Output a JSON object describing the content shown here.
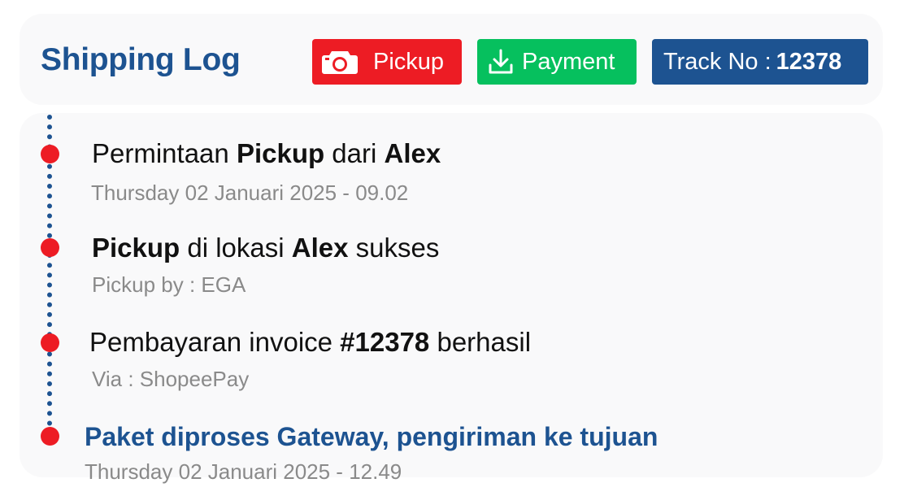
{
  "header": {
    "title": "Shipping Log",
    "pickup_label": "Pickup",
    "payment_label": "Payment",
    "track_prefix": "Track No :",
    "track_number": "12378"
  },
  "colors": {
    "brand_blue": "#1d5391",
    "pickup_red": "#ed1c24",
    "payment_green": "#06c05e"
  },
  "icons": {
    "pickup": "camera-icon",
    "payment": "download-icon"
  },
  "events": [
    {
      "title_parts": [
        "Permintaan ",
        "Pickup",
        " dari ",
        "Alex"
      ],
      "subtitle": "Thursday 02 Januari 2025 - 09.02"
    },
    {
      "title_parts": [
        "Pickup",
        " di lokasi ",
        "Alex",
        " sukses"
      ],
      "subtitle": "Pickup by : EGA"
    },
    {
      "title_parts": [
        "Pembayaran invoice ",
        "#12378",
        " berhasil"
      ],
      "subtitle": "Via : ShopeePay"
    },
    {
      "title": "Paket diproses Gateway, pengiriman ke tujuan",
      "subtitle": "Thursday 02 Januari 2025 - 12.49"
    }
  ]
}
